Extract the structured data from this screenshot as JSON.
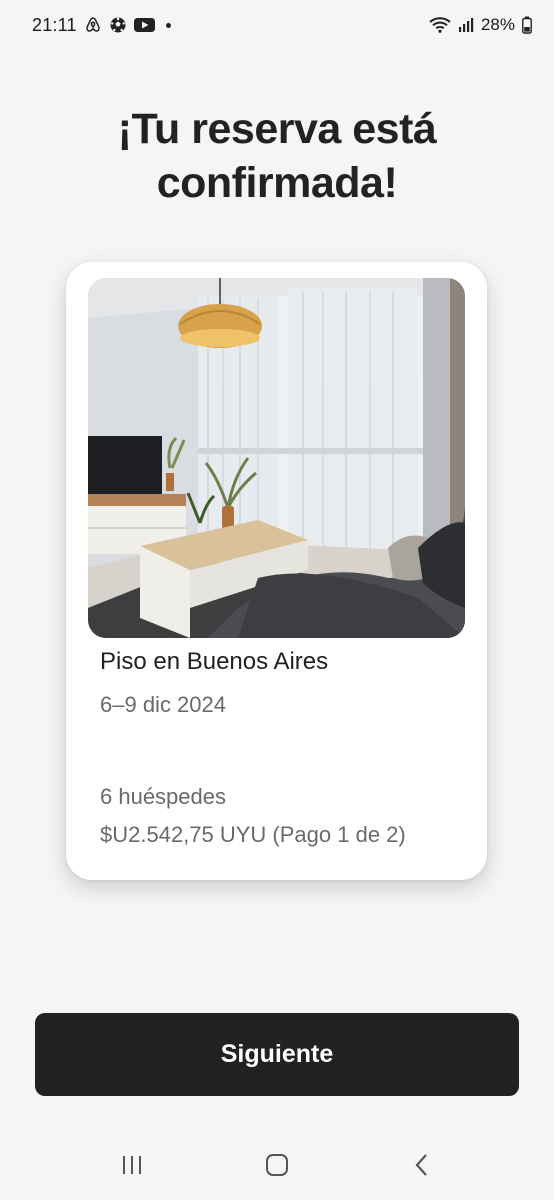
{
  "status_bar": {
    "time": "21:11",
    "battery": "28%",
    "icons": [
      "airbnb-icon",
      "soccer-ball-icon",
      "youtube-icon",
      "notification-dot",
      "wifi-icon",
      "signal-icon",
      "battery-icon"
    ]
  },
  "page": {
    "title": "¡Tu reserva está confirmada!"
  },
  "booking": {
    "listing_title": "Piso en Buenos Aires",
    "dates": "6–9 dic 2024",
    "guests": "6 huéspedes",
    "price": "$U2.542,75 UYU (Pago 1 de 2)",
    "photo_alt": "living-room-photo"
  },
  "actions": {
    "next_label": "Siguiente"
  },
  "nav": {
    "icons": [
      "recent-apps-icon",
      "home-icon",
      "back-icon"
    ]
  },
  "colors": {
    "background": "#f6f5f3",
    "button": "#222222",
    "text_primary": "#222222",
    "text_secondary": "#6a6a6a"
  }
}
